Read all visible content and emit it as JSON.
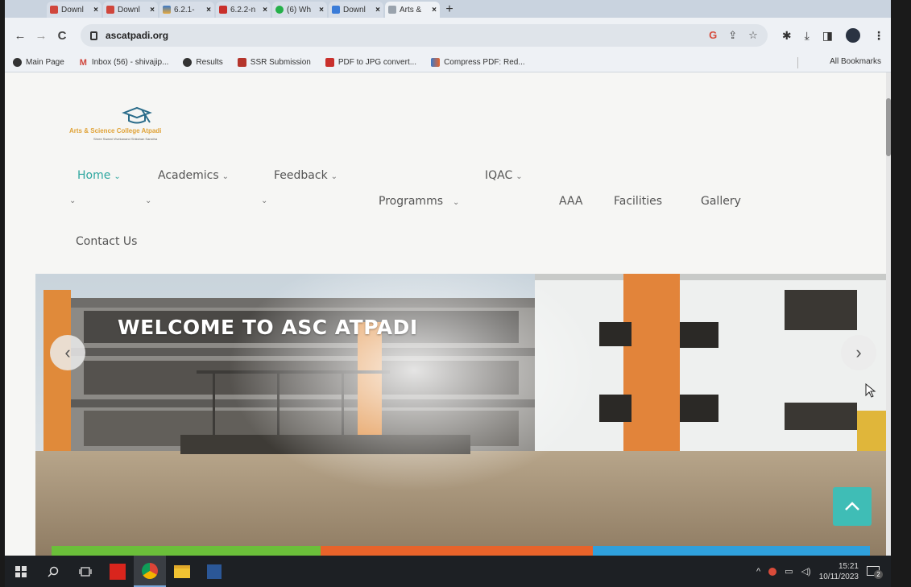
{
  "browser": {
    "tabs": [
      {
        "label": "Downl",
        "color": "#d0463c"
      },
      {
        "label": "Downl",
        "color": "#d0463c"
      },
      {
        "label": "6.2.1-",
        "color": "#3a79c9"
      },
      {
        "label": "6.2.2-n",
        "color": "#c9302c"
      },
      {
        "label": "(6) Wh",
        "color": "#25b04a"
      },
      {
        "label": "Downl",
        "color": "#3b7cd8"
      },
      {
        "label": "Arts &",
        "color": "#9aa3ad",
        "active": true
      }
    ],
    "tab_close": "×",
    "new_tab": "+",
    "url": "ascatpadi.org",
    "back": "←",
    "forward": "→",
    "reload": "C",
    "omni_icons": [
      "G",
      "⇪",
      "☆"
    ],
    "tool_icons": [
      "✱",
      "⤓",
      "◨"
    ],
    "menu_dots": "⋮",
    "bookmarks": [
      {
        "label": "Main Page",
        "icon": "globe-icon",
        "color": "#333"
      },
      {
        "label": "Inbox (56) - shivajip...",
        "icon": "gmail-icon",
        "color": "#d0463c"
      },
      {
        "label": "Results",
        "icon": "globe-icon",
        "color": "#333"
      },
      {
        "label": "SSR Submission",
        "icon": "ssr-icon",
        "color": "#b5352c"
      },
      {
        "label": "PDF to JPG convert...",
        "icon": "pdf-icon",
        "color": "#c9302c"
      },
      {
        "label": "Compress PDF: Red...",
        "icon": "compress-icon",
        "color": "#3a79c9"
      }
    ],
    "all_bookmarks": "All Bookmarks"
  },
  "site": {
    "logo_text": "Arts & Science College Atpadi",
    "logo_sub": "Shree Swami Vivekanand Shikshan Sanstha",
    "nav": {
      "home": "Home",
      "academics": "Academics",
      "feedback": "Feedback",
      "iqac": "IQAC",
      "programms": "Programms",
      "aaa": "AAA",
      "facilities": "Facilities",
      "gallery": "Gallery",
      "contact": "Contact Us"
    },
    "caret": "⌄",
    "hero_title": "WELCOME TO ASC ATPADI",
    "prev_arrow": "‹",
    "next_arrow": "›",
    "bar_colors": [
      "#6bbf3a",
      "#e8632a",
      "#2fa0dc"
    ],
    "accent": "#2fa7a0"
  },
  "taskbar": {
    "time": "15:21",
    "date": "10/11/2023",
    "notification_count": "2"
  }
}
